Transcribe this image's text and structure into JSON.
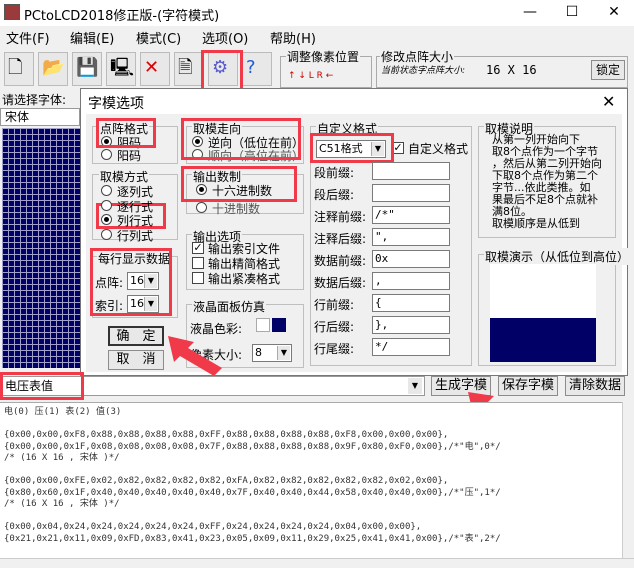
{
  "app": {
    "title": "PCtoLCD2018修正版-(字符模式)"
  },
  "menu": [
    {
      "label": "文件(F)"
    },
    {
      "label": "编辑(E)"
    },
    {
      "label": "模式(C)"
    },
    {
      "label": "选项(O)"
    },
    {
      "label": "帮助(H)"
    }
  ],
  "toolbar": {
    "adjust_group": "调整像素位置",
    "modify_group": "修改点阵大小",
    "current_size_label": "当前状态字点阵大小:",
    "current_size": "16 X 16",
    "lock_label": "锁定"
  },
  "left_panel": {
    "font_label": "请选择字体:",
    "font_value": "宋体"
  },
  "dialog": {
    "title": "字模选项",
    "dot_format": {
      "label": "点阵格式",
      "options": [
        "阴码",
        "阳码"
      ],
      "selected": 0
    },
    "direction": {
      "label": "取模走向",
      "options": [
        "逆向（低位在前）",
        "顺向（高位在前）"
      ],
      "selected": 0
    },
    "mode": {
      "label": "取模方式",
      "options": [
        "逐列式",
        "逐行式",
        "列行式",
        "行列式"
      ],
      "selected": 2
    },
    "output_base": {
      "label": "输出数制",
      "options": [
        "十六进制数",
        "十进制数"
      ],
      "selected": 0
    },
    "per_line": {
      "label": "每行显示数据",
      "dot_label": "点阵:",
      "dot_value": "16",
      "index_label": "索引:",
      "index_value": "16"
    },
    "output_opts": {
      "label": "输出选项",
      "items": [
        "输出索引文件",
        "输出精简格式",
        "输出紧凑格式"
      ],
      "checked": [
        true,
        false,
        false
      ]
    },
    "lcd_sim": {
      "label": "液晶面板仿真",
      "color_label": "液晶色彩:",
      "pixel_label": "像素大小:",
      "pixel_value": "8"
    },
    "custom": {
      "label": "自定义格式",
      "preset": "C51格式",
      "custom_check_label": "自定义格式",
      "rows": [
        {
          "label": "段前缀:",
          "value": ""
        },
        {
          "label": "段后缀:",
          "value": ""
        },
        {
          "label": "注释前缀:",
          "value": "/*\""
        },
        {
          "label": "注释后缀:",
          "value": "\","
        },
        {
          "label": "数据前缀:",
          "value": "0x"
        },
        {
          "label": "数据后缀:",
          "value": ","
        },
        {
          "label": "行前缀:",
          "value": "{"
        },
        {
          "label": "行后缀:",
          "value": "},"
        },
        {
          "label": "行尾缀:",
          "value": "*/"
        }
      ]
    },
    "explain": {
      "label": "取模说明",
      "text": [
        "从第一列开始向下",
        "取8个点作为一个字节",
        "，然后从第二列开始向",
        "下取8个点作为第二个",
        "字节...依此类推。如",
        "果最后不足8个点就补",
        "满8位。",
        "取模顺序是从低到"
      ]
    },
    "demo": {
      "label": "取模演示（从低位到高位）"
    },
    "ok_label": "确　定",
    "cancel_label": "取　消"
  },
  "bottom": {
    "input_value": "电压表值",
    "gen_label": "生成字模",
    "save_label": "保存字模",
    "clear_label": "清除数据",
    "lines": [
      "电(0) 压(1) 表(2) 值(3)",
      "",
      "{0x00,0x00,0xF8,0x88,0x88,0x88,0x88,0xFF,0x88,0x88,0x88,0x88,0xF8,0x00,0x00,0x00},",
      "{0x00,0x00,0x1F,0x08,0x08,0x08,0x08,0x7F,0x88,0x88,0x88,0x88,0x9F,0x80,0xF0,0x00},/*\"电\",0*/",
      "/* (16 X 16 , 宋体 )*/",
      "",
      "{0x00,0x00,0xFE,0x02,0x82,0x82,0x82,0x82,0xFA,0x82,0x82,0x82,0x82,0x82,0x02,0x00},",
      "{0x80,0x60,0x1F,0x40,0x40,0x40,0x40,0x40,0x7F,0x40,0x40,0x44,0x58,0x40,0x40,0x00},/*\"压\",1*/",
      "/* (16 X 16 , 宋体 )*/",
      "",
      "{0x00,0x04,0x24,0x24,0x24,0x24,0x24,0xFF,0x24,0x24,0x24,0x24,0x04,0x00,0x00},",
      "{0x21,0x21,0x11,0x09,0xFD,0x83,0x41,0x23,0x05,0x09,0x11,0x29,0x25,0x41,0x41,0x00},/*\"表\",2*/"
    ]
  },
  "colors": {
    "annotation": "#f03a4a",
    "lcd_bg": "#000066",
    "lcd_fg": "#ffffff"
  }
}
